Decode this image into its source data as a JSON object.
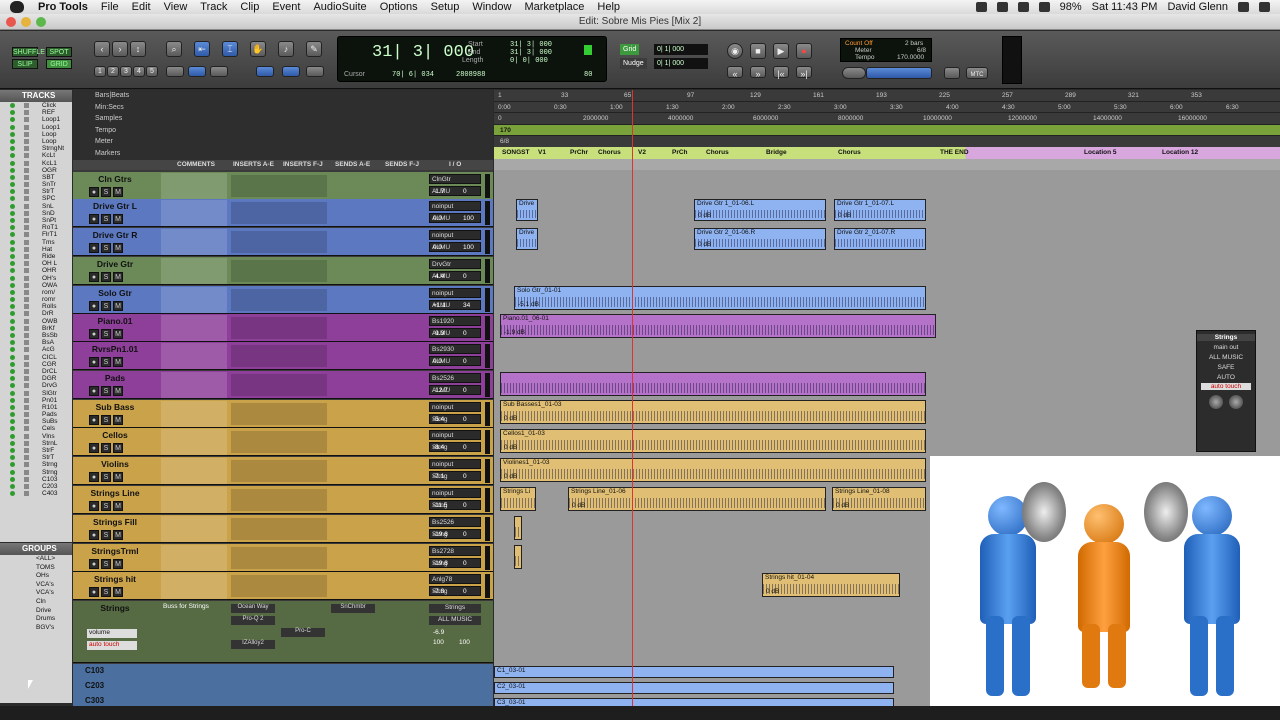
{
  "menubar": {
    "app": "Pro Tools",
    "items": [
      "File",
      "Edit",
      "View",
      "Track",
      "Clip",
      "Event",
      "AudioSuite",
      "Options",
      "Setup",
      "Window",
      "Marketplace",
      "Help"
    ],
    "battery": "98%",
    "clock": "Sat 11:43 PM",
    "user": "David Glenn"
  },
  "window": {
    "title": "Edit: Sobre Mis Pies [Mix 2]"
  },
  "toolbar": {
    "modes": [
      "SHUFFLE",
      "SPOT",
      "SLIP",
      "GRID"
    ],
    "zoom_presets": [
      "1",
      "2",
      "3",
      "4",
      "5"
    ],
    "main_counter": "31| 3| 000",
    "start_label": "Start",
    "start_value": "31| 3| 000",
    "end_label": "End",
    "end_value": "31| 3| 000",
    "length_label": "Length",
    "length_value": "0| 0| 000",
    "cursor_label": "Cursor",
    "cursor_value": "70| 6| 034",
    "samples_value": "2808988",
    "grid_label": "Grid",
    "grid_value": "0| 1| 000",
    "nudge_label": "Nudge",
    "nudge_value": "0| 1| 000",
    "tempo_display": "80",
    "count_off": "Count Off",
    "count_off_value": "2 bars",
    "meter_label": "Meter",
    "meter_value": "6/8",
    "tempo_label": "Tempo",
    "tempo_value": "170.0000",
    "mtc": "MTC"
  },
  "tracklist": {
    "header": "TRACKS",
    "items": [
      "Click",
      "REF",
      "Loop1",
      "Loop1",
      "Loop",
      "Loop",
      "StrngNt",
      "KcLt",
      "KcL1",
      "OGR",
      "SBT",
      "SnTr",
      "StrT",
      "SPC",
      "SnL",
      "SnD",
      "SnPt",
      "RoT1",
      "FlrT1",
      "Tms",
      "Hat",
      "Ride",
      "OH L",
      "OHR",
      "OH's",
      "OWA",
      "rom/",
      "romr",
      "Rolls",
      "DrR",
      "OWB",
      "BrKf",
      "BsSb",
      "BsA",
      "AcG",
      "CICL",
      "CGR",
      "DrCL",
      "DGR",
      "DrvG",
      "SlGtr",
      "Pn01",
      "R101",
      "Pads",
      "SuBs",
      "Cels",
      "Vlns",
      "StrnL",
      "StrF",
      "StrT",
      "Strng",
      "Strng",
      "C103",
      "C203",
      "C403"
    ]
  },
  "groups": {
    "header": "GROUPS",
    "items": [
      "<ALL>",
      "TOMS",
      "OHs",
      "VCA's",
      "VCA's",
      "Cln",
      "Drive",
      "Drums",
      "BGV's"
    ]
  },
  "mix_rulers": [
    "Bars|Beats",
    "Min:Secs",
    "Samples",
    "Tempo",
    "Meter",
    "Markers"
  ],
  "columns": [
    "COMMENTS",
    "INSERTS A-E",
    "INSERTS F-J",
    "SENDS A-E",
    "SENDS F-J",
    "I / O"
  ],
  "tracks": [
    {
      "name": "Cln Gtrs",
      "color": "#6b8a57",
      "in": "ClnGtr",
      "out": "ALMU",
      "vol": "-1.7",
      "pan": "0"
    },
    {
      "name": "Drive Gtr L",
      "color": "#5b78c0",
      "in": "noinput",
      "out": "ALMU",
      "vol": "0.0",
      "pan": "100"
    },
    {
      "name": "Drive Gtr R",
      "color": "#5b78c0",
      "in": "noinput",
      "out": "ALMU",
      "vol": "0.0",
      "pan": "100"
    },
    {
      "name": "Drive Gtr",
      "color": "#6b8a57",
      "in": "DrvGtr",
      "out": "ALMU",
      "vol": "-4.4",
      "pan": "0"
    },
    {
      "name": "Solo Gtr",
      "color": "#5b78c0",
      "in": "noinput",
      "out": "ALMU",
      "vol": "+1.1",
      "pan": "34"
    },
    {
      "name": "Piano.01",
      "color": "#8e3f99",
      "in": "Bs1920",
      "out": "ALMU",
      "vol": "-9.3",
      "pan": "0"
    },
    {
      "name": "RvrsPn1.01",
      "color": "#8e3f99",
      "in": "Bs2930",
      "out": "ALMU",
      "vol": "0.0",
      "pan": "0"
    },
    {
      "name": "Pads",
      "color": "#8e3f99",
      "in": "Bs2526",
      "out": "ALMU",
      "vol": "-12.7",
      "pan": "0"
    },
    {
      "name": "Sub Bass",
      "color": "#c9a24a",
      "in": "noinput",
      "out": "Strng",
      "vol": "-5.4",
      "pan": "0"
    },
    {
      "name": "Cellos",
      "color": "#c9a24a",
      "in": "noinput",
      "out": "Strng",
      "vol": "-8.4",
      "pan": "0"
    },
    {
      "name": "Violins",
      "color": "#c9a24a",
      "in": "noinput",
      "out": "Strng",
      "vol": "-7.1",
      "pan": "0"
    },
    {
      "name": "Strings Line",
      "color": "#c9a24a",
      "in": "noinput",
      "out": "Strng",
      "vol": "-11.5",
      "pan": "0"
    },
    {
      "name": "Strings Fill",
      "color": "#c9a24a",
      "in": "Bs2526",
      "out": "Strng",
      "vol": "-19.8",
      "pan": "0"
    },
    {
      "name": "StringsTrml",
      "color": "#c9a24a",
      "in": "Bs2728",
      "out": "Strng",
      "vol": "-19.8",
      "pan": "0"
    },
    {
      "name": "Strings hit",
      "color": "#c9a24a",
      "in": "Anlg78",
      "out": "Strng",
      "vol": "-7.8",
      "pan": "0"
    }
  ],
  "aux_track": {
    "name": "Strings",
    "comment": "Buss for Strings",
    "inserts": [
      "Ocean Way",
      "Pro-Q 2",
      "IZAlloy2"
    ],
    "inserts_fj": [
      "Pro-C"
    ],
    "send": "SnChmbr",
    "input": "Strings",
    "output": "ALL MUSIC",
    "vol": "-6.9",
    "pan_l": "100",
    "pan_r": "100",
    "automation": "volume",
    "mode": "auto touch"
  },
  "vca_tracks": [
    "C103",
    "C203",
    "C303"
  ],
  "timeline": {
    "bars": [
      "1",
      "33",
      "65",
      "97",
      "129",
      "161",
      "193",
      "225",
      "257",
      "289",
      "321",
      "353"
    ],
    "minsecs": [
      "0:00",
      "0:30",
      "1:00",
      "1:30",
      "2:00",
      "2:30",
      "3:00",
      "3:30",
      "4:00",
      "4:30",
      "5:00",
      "5:30",
      "6:00",
      "6:30"
    ],
    "samples": [
      "0",
      "2000000",
      "4000000",
      "6000000",
      "8000000",
      "10000000",
      "12000000",
      "14000000",
      "16000000"
    ],
    "tempo": "170",
    "meter": "6/8",
    "markers": [
      "SONGST",
      "V1",
      "PrChr",
      "Chorus",
      "V2",
      "PrCh",
      "Chorus",
      "Bridge",
      "Chorus",
      "THE END",
      "Location 5",
      "Location 12"
    ]
  },
  "clips": {
    "drive_l": [
      "Drive",
      "Drive Gtr 1_01-06.L",
      "Drive Gtr 1_01-07.L"
    ],
    "drive_r": [
      "Drive",
      "Drive Gtr 2_01-06.R",
      "Drive Gtr 2_01-07.R"
    ],
    "solo": "Solo Gtr_01-01",
    "piano": "Piano.01_06-01",
    "sub_bass": "Sub Basses1_01-03",
    "cellos": "Cellos1_01-03",
    "violins": "Violines1_01-03",
    "strings_line": [
      "Strings Li",
      "Strings Line_01-06",
      "Strings Line_01-08"
    ],
    "strings_hit": "Strings hit_01-04",
    "c_clips": [
      "C1_03-01",
      "C2_03-01",
      "C3_03-01"
    ],
    "gains": [
      "0 dB",
      "0 dB",
      "0 dB",
      "-5.1 dB",
      "-1.9 dB",
      "0 dB",
      "0 dB",
      "0 dB",
      "0 dB",
      "0 dB",
      "0 dB"
    ]
  },
  "plugin_window": {
    "name": "Strings",
    "path": "main out",
    "bus": "ALL MUSIC",
    "safe": "SAFE",
    "auto": "AUTO",
    "mode": "auto touch"
  },
  "colors": {
    "accent": "#5b78c0",
    "green": "#6b8a57",
    "purple": "#8e3f99",
    "gold": "#c9a24a",
    "figure_blue": "#2e7fd6",
    "figure_orange": "#f08a1c"
  }
}
